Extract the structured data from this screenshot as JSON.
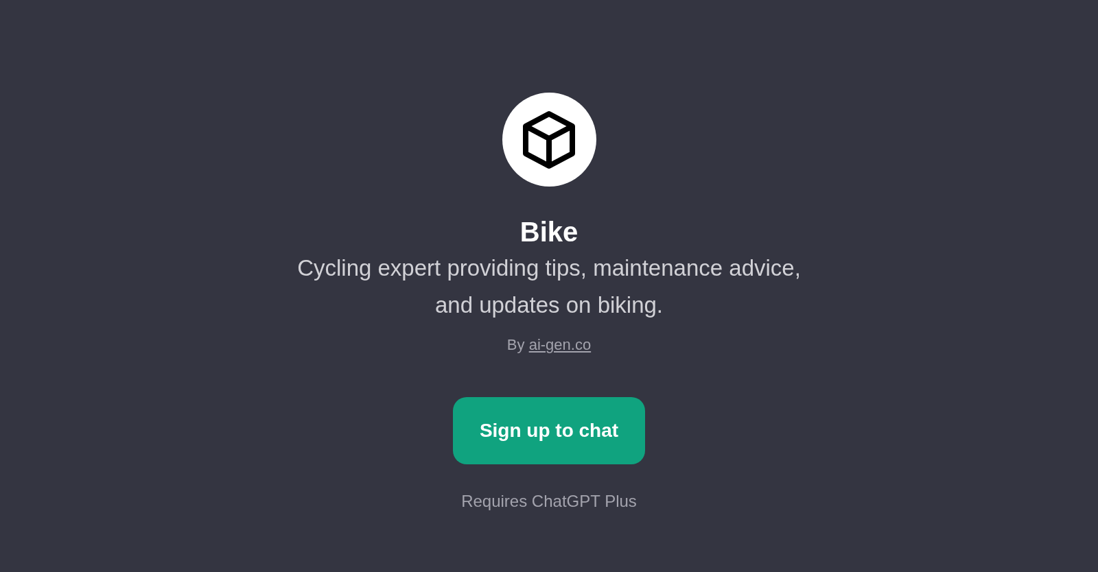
{
  "gpt": {
    "name": "Bike",
    "description": "Cycling expert providing tips, maintenance advice, and updates on biking.",
    "author_prefix": "By",
    "author_link": "ai-gen.co"
  },
  "signup_button": "Sign up to chat",
  "footnote": "Requires ChatGPT Plus"
}
